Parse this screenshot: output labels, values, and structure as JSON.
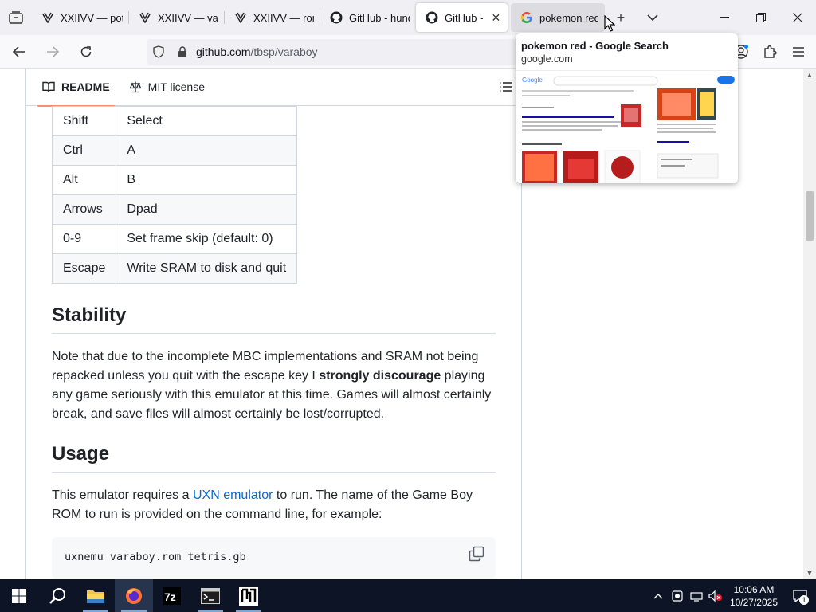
{
  "browser": {
    "tabs": [
      {
        "title": "XXIIVV — pota",
        "icon": "xxiivv-icon"
      },
      {
        "title": "XXIIVV — varv",
        "icon": "xxiivv-icon"
      },
      {
        "title": "XXIIVV — rom",
        "icon": "xxiivv-icon"
      },
      {
        "title": "GitHub - hund",
        "icon": "github-icon"
      },
      {
        "title": "GitHub - tb",
        "icon": "github-icon"
      },
      {
        "title": "pokemon red",
        "icon": "google-icon"
      }
    ],
    "url_host": "github.com",
    "url_path": "/tbsp/varaboy",
    "preview": {
      "title": "pokemon red - Google Search",
      "host": "google.com"
    }
  },
  "readme": {
    "tabs": [
      {
        "label": "README",
        "icon": "book-icon"
      },
      {
        "label": "MIT license",
        "icon": "scale-icon"
      }
    ],
    "keys_table": [
      {
        "key": "Shift",
        "action": "Select"
      },
      {
        "key": "Ctrl",
        "action": "A"
      },
      {
        "key": "Alt",
        "action": "B"
      },
      {
        "key": "Arrows",
        "action": "Dpad"
      },
      {
        "key": "0-9",
        "action": "Set frame skip (default: 0)"
      },
      {
        "key": "Escape",
        "action": "Write SRAM to disk and quit"
      }
    ],
    "stability": {
      "heading": "Stability",
      "text_before": "Note that due to the incomplete MBC implementations and SRAM not being repacked unless you quit with the escape key I ",
      "text_strong": "strongly discourage",
      "text_after": " playing any game seriously with this emulator at this time. Games will almost certainly break, and save files will almost certainly be lost/corrupted."
    },
    "usage": {
      "heading": "Usage",
      "text_before": "This emulator requires a ",
      "link": "UXN emulator",
      "text_after": " to run. The name of the Game Boy ROM to run is provided on the command line, for example:",
      "code": "uxnemu varaboy.rom tetris.gb"
    }
  },
  "taskbar": {
    "apps": [
      "start-icon",
      "search-icon",
      "file-explorer-icon",
      "firefox-icon",
      "7zip-icon",
      "terminal-icon",
      "uxn-icon"
    ],
    "time": "10:06 AM",
    "date": "10/27/2025",
    "notification_count": "1"
  },
  "colors": {
    "link": "#0969da",
    "tab_underline": "#fd8c73",
    "taskbar": "#0c1426"
  }
}
